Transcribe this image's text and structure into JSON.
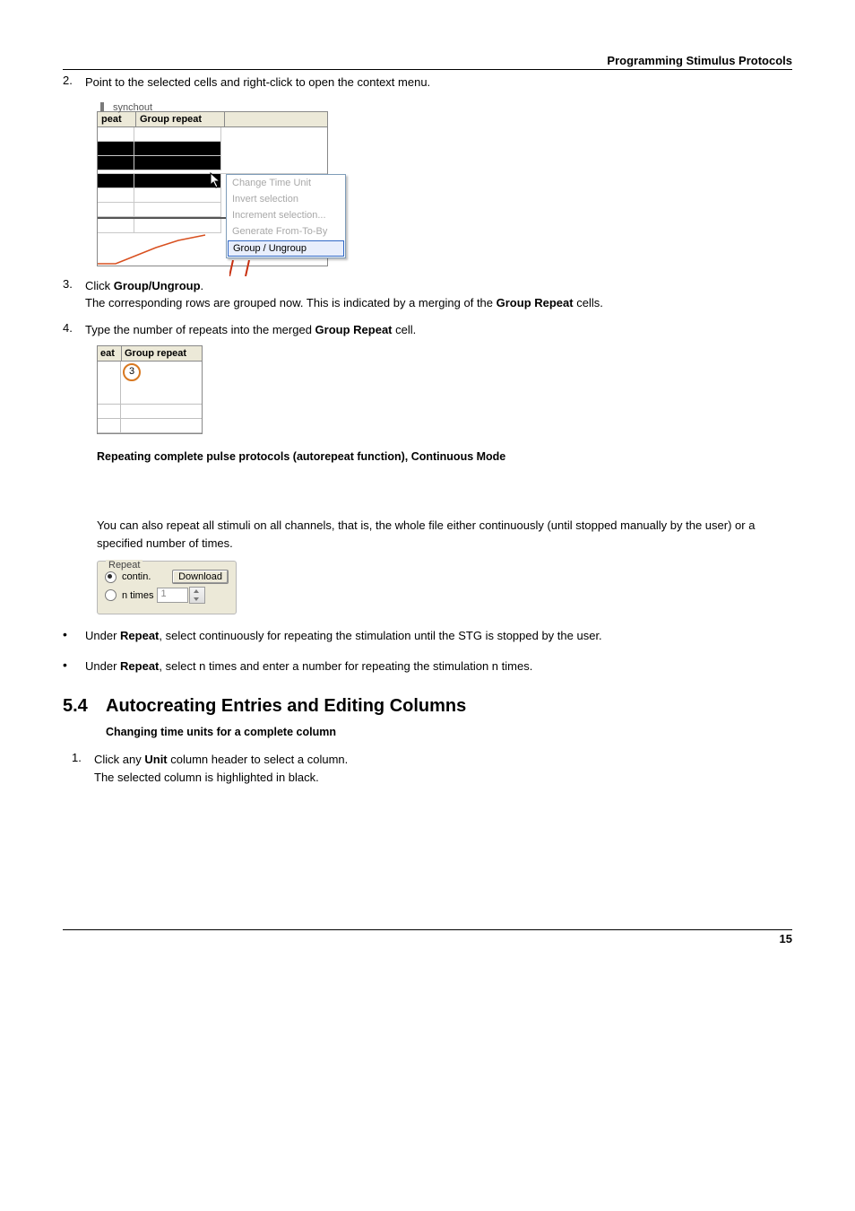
{
  "header": {
    "title": "Programming Stimulus Protocols"
  },
  "step2": {
    "num": "2.",
    "text": "Point to the selected cells and right-click to open the context menu."
  },
  "shot1": {
    "syn": "synchout",
    "col_peat": "peat",
    "col_gr": "Group repeat",
    "menu": {
      "change": "Change Time Unit",
      "invert": "Invert selection",
      "increment": "Increment selection...",
      "generate": "Generate From-To-By",
      "group": "Group / Ungroup"
    }
  },
  "step3": {
    "num": "3.",
    "label": "Click ",
    "bold1": "Group/Ungroup",
    "after1": ".",
    "line2a": "The corresponding rows are grouped now. This is indicated by a merging of the ",
    "bold2": "Group Repeat",
    "line2b": " cells."
  },
  "step4": {
    "num": "4.",
    "a": "Type the number of repeats into the merged ",
    "b": "Group Repeat",
    "c": " cell."
  },
  "shot2": {
    "h1": "eat",
    "h2": "Group repeat",
    "val": "3"
  },
  "sect_repeat": "Repeating complete pulse protocols (autorepeat function), Continuous Mode",
  "para": "You can also repeat all stimuli on all channels, that is, the whole file either continuously (until stopped manually by the user) or a specified number of times.",
  "shot3": {
    "legend": "Repeat",
    "contin": "contin.",
    "download": "Download",
    "ntimes": "n times",
    "val": "1"
  },
  "bullets": {
    "b1a": "Under ",
    "b1b": "Repeat",
    "b1c": ", select continuously for repeating the stimulation until the STG is stopped by the user.",
    "b2a": "Under ",
    "b2b": "Repeat",
    "b2c": ", select n times and enter a number for repeating the stimulation n times."
  },
  "h2": {
    "num": "5.4",
    "title": "Autocreating Entries and Editing Columns"
  },
  "subh": "Changing time units for a complete column",
  "last": {
    "num": "1.",
    "a": "Click any ",
    "b": "Unit",
    "c": " column header to select a column.",
    "d": "The selected column is highlighted in black."
  },
  "footer": {
    "page": "15"
  },
  "chart_data": {
    "type": "table",
    "tables": [
      {
        "columns": [
          "peat",
          "Group repeat"
        ],
        "selected_rows": 3,
        "context_menu_items": [
          "Change Time Unit",
          "Invert selection",
          "Increment selection...",
          "Generate From-To-By",
          "Group / Ungroup"
        ],
        "active_item": "Group / Ungroup"
      },
      {
        "columns": [
          "eat",
          "Group repeat"
        ],
        "rows": [
          {
            "Group repeat": 3
          }
        ]
      }
    ],
    "repeat_panel": {
      "options": [
        "contin.",
        "n times"
      ],
      "selected": "contin.",
      "n_value": 1,
      "button": "Download"
    }
  }
}
